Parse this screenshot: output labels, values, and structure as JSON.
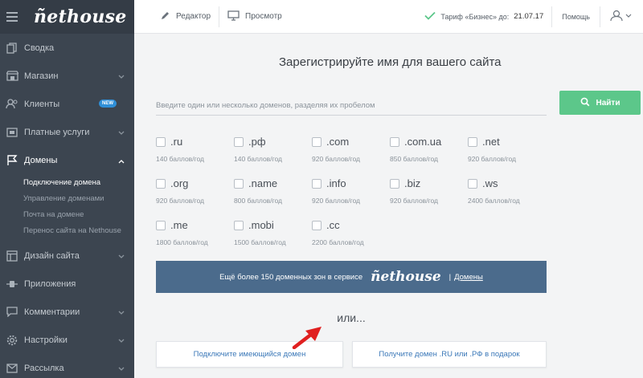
{
  "brand": {
    "logo_text": "ñethouse"
  },
  "sidebar": {
    "items": [
      {
        "label": "Сводка",
        "icon": "copy-icon"
      },
      {
        "label": "Магазин",
        "icon": "store-icon",
        "has_chevron": true
      },
      {
        "label": "Клиенты",
        "icon": "users-icon",
        "badge": "NEW"
      },
      {
        "label": "Платные услуги",
        "icon": "wallet-icon",
        "has_chevron": true
      },
      {
        "label": "Домены",
        "icon": "flag-icon",
        "has_chevron": true,
        "active": true
      },
      {
        "label": "Дизайн сайта",
        "icon": "layout-icon",
        "has_chevron": true
      },
      {
        "label": "Приложения",
        "icon": "plug-icon"
      },
      {
        "label": "Комментарии",
        "icon": "chat-icon",
        "has_chevron": true
      },
      {
        "label": "Настройки",
        "icon": "gear-icon",
        "has_chevron": true
      },
      {
        "label": "Рассылка",
        "icon": "mail-icon",
        "has_chevron": true
      }
    ],
    "domains_subitems": [
      "Подключение домена",
      "Управление доменами",
      "Почта на домене",
      "Перенос сайта на Nethouse"
    ]
  },
  "topbar": {
    "editor_label": "Редактор",
    "preview_label": "Просмотр",
    "tariff_label": "Тариф «Бизнес» до:",
    "tariff_date": "21.07.17",
    "help_label": "Помощь"
  },
  "main": {
    "heading": "Зарегистрируйте имя для вашего сайта",
    "search_placeholder": "Введите один или несколько доменов, разделяя их пробелом",
    "search_value": "",
    "find_button": "Найти",
    "zones": [
      {
        "name": ".ru",
        "price": "140 баллов/год"
      },
      {
        "name": ".рф",
        "price": "140 баллов/год"
      },
      {
        "name": ".com",
        "price": "920 баллов/год"
      },
      {
        "name": ".com.ua",
        "price": "850 баллов/год"
      },
      {
        "name": ".net",
        "price": "920 баллов/год"
      },
      {
        "name": ".org",
        "price": "920 баллов/год"
      },
      {
        "name": ".name",
        "price": "800 баллов/год"
      },
      {
        "name": ".info",
        "price": "920 баллов/год"
      },
      {
        "name": ".biz",
        "price": "920 баллов/год"
      },
      {
        "name": ".ws",
        "price": "2400 баллов/год"
      },
      {
        "name": ".me",
        "price": "1800 баллов/год"
      },
      {
        "name": ".mobi",
        "price": "1500 баллов/год"
      },
      {
        "name": ".cc",
        "price": "2200 баллов/год"
      }
    ],
    "promo_text": "Ещё более 150 доменных зон в сервисе",
    "promo_logo": "ñethouse",
    "promo_separator": "|",
    "promo_link": "Домены",
    "or_text": "или...",
    "connect_button": "Подключите имеющийся домен",
    "gift_button": "Получите домен .RU или .РФ в подарок"
  },
  "colors": {
    "sidebar_bg": "#3c4550",
    "accent_green": "#5cc78a",
    "promo_bg": "#4b6b8c",
    "link_blue": "#3b78b8",
    "arrow_red": "#e02020"
  }
}
